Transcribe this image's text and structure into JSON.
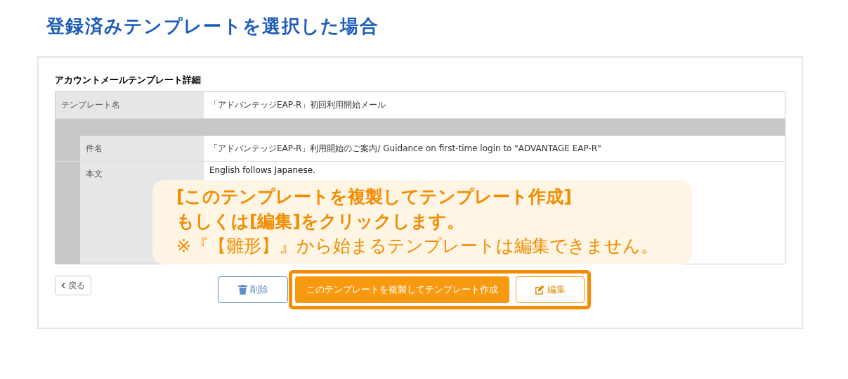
{
  "page_title": "登録済みテンプレートを選択した場合",
  "card": {
    "heading": "アカウントメールテンプレート詳細",
    "rows": [
      {
        "label": "テンプレート名",
        "value": "「アドバンテッジEAP-R」初回利用開始メール",
        "kind": "top"
      },
      {
        "label": "件名",
        "value": "「アドバンテッジEAP-R」利用開始のご案内/ Guidance on first-time login to \"ADVANTAGE EAP-R\"",
        "kind": "nested"
      },
      {
        "label": "本文",
        "value": "English follows Japanese.",
        "kind": "nested"
      }
    ]
  },
  "buttons": [
    {
      "kind": "back",
      "label": "戻る"
    },
    {
      "kind": "delete",
      "label": "削除"
    },
    {
      "kind": "primary",
      "label": "このテンプレートを複製してテンプレート作成"
    },
    {
      "kind": "edit",
      "label": "編集"
    }
  ],
  "callout": {
    "lines": [
      {
        "text": "[このテンプレートを複製してテンプレート作成]",
        "bold": true
      },
      {
        "text": "もしくは[編集]をクリックします。",
        "bold": true
      },
      {
        "text": "※『【雛形】』から始まるテンプレートは編集できません。",
        "bold": false
      }
    ]
  }
}
